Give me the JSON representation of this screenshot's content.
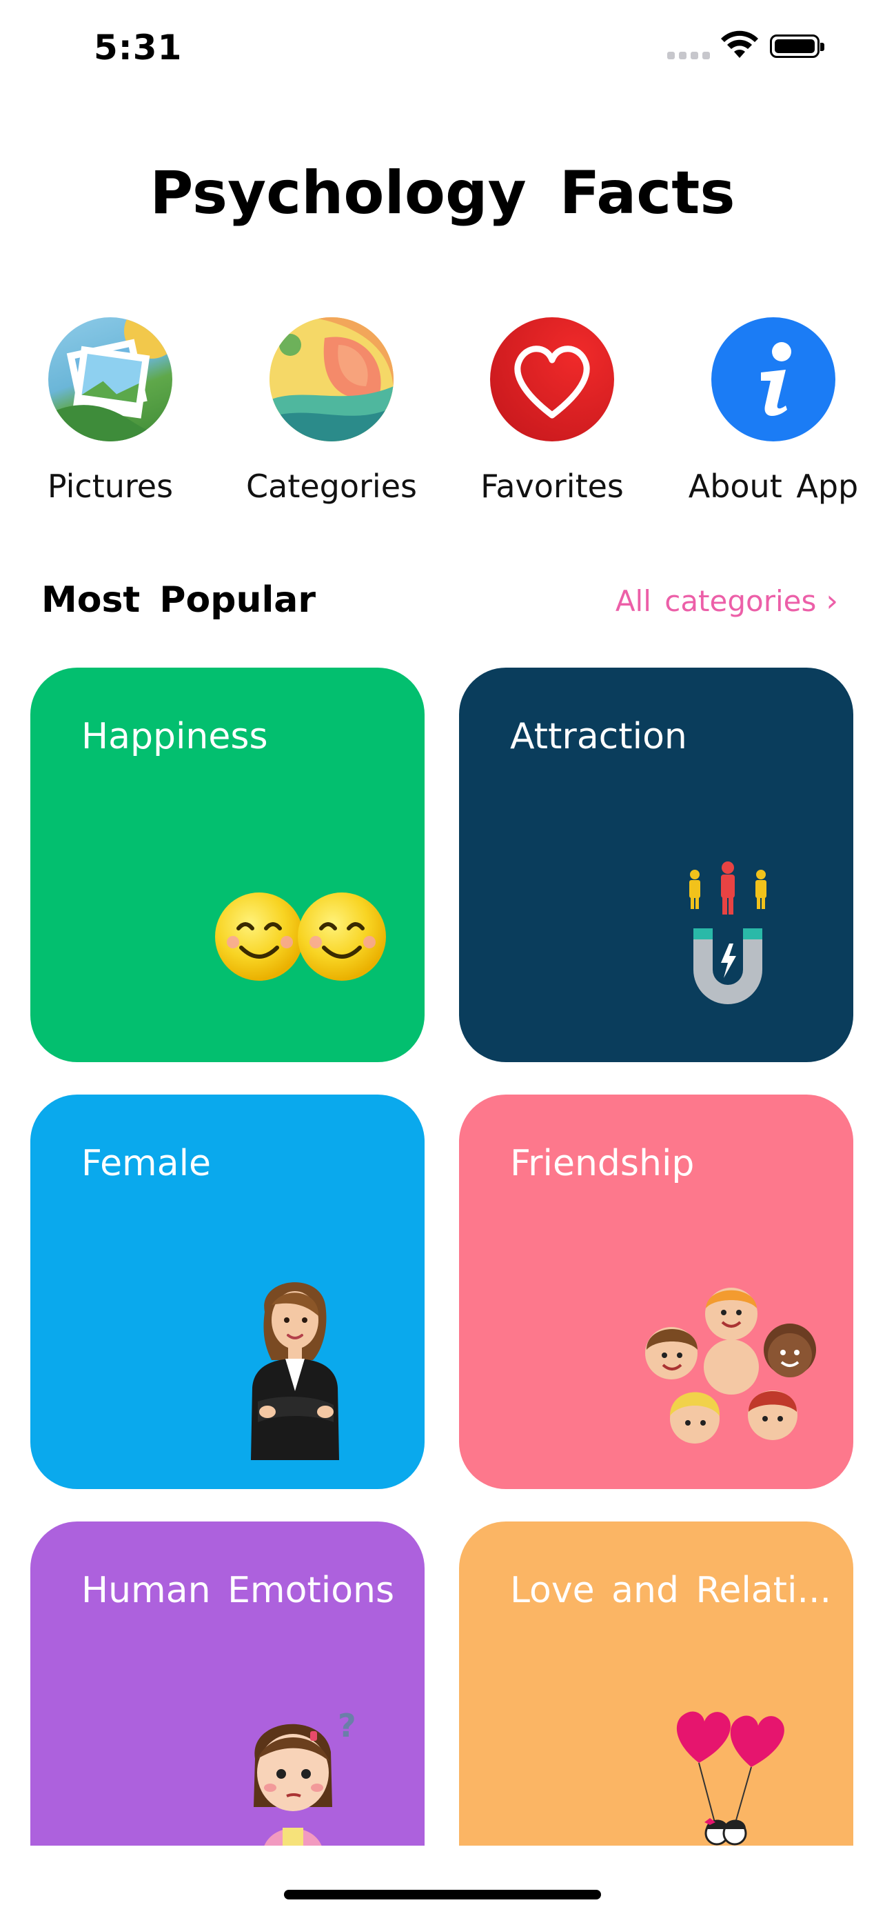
{
  "status_bar": {
    "time": "5:31"
  },
  "title": "Psychology Facts",
  "quick_menu": [
    {
      "label": "Pictures",
      "icon": "pictures-icon"
    },
    {
      "label": "Categories",
      "icon": "categories-icon"
    },
    {
      "label": "Favorites",
      "icon": "heart-icon"
    },
    {
      "label": "About App",
      "icon": "info-icon"
    }
  ],
  "section": {
    "title": "Most Popular",
    "link": "All categories"
  },
  "cards": [
    {
      "title": "Happiness",
      "color": "#03bf6f",
      "icon": "smiling-faces-icon"
    },
    {
      "title": "Attraction",
      "color": "#0a3d5c",
      "icon": "magnet-people-icon"
    },
    {
      "title": "Female",
      "color": "#0aa9ed",
      "icon": "businesswoman-icon"
    },
    {
      "title": "Friendship",
      "color": "#fd788c",
      "icon": "kids-circle-icon"
    },
    {
      "title": "Human Emotions",
      "color": "#ad61dd",
      "icon": "confused-girl-icon"
    },
    {
      "title": "Love and Relati...",
      "color": "#fbb564",
      "icon": "love-balloons-icon"
    }
  ],
  "colors": {
    "accent_link": "#ec5fa8",
    "favorites_red": "#e02424",
    "about_blue": "#1b7cf5"
  }
}
